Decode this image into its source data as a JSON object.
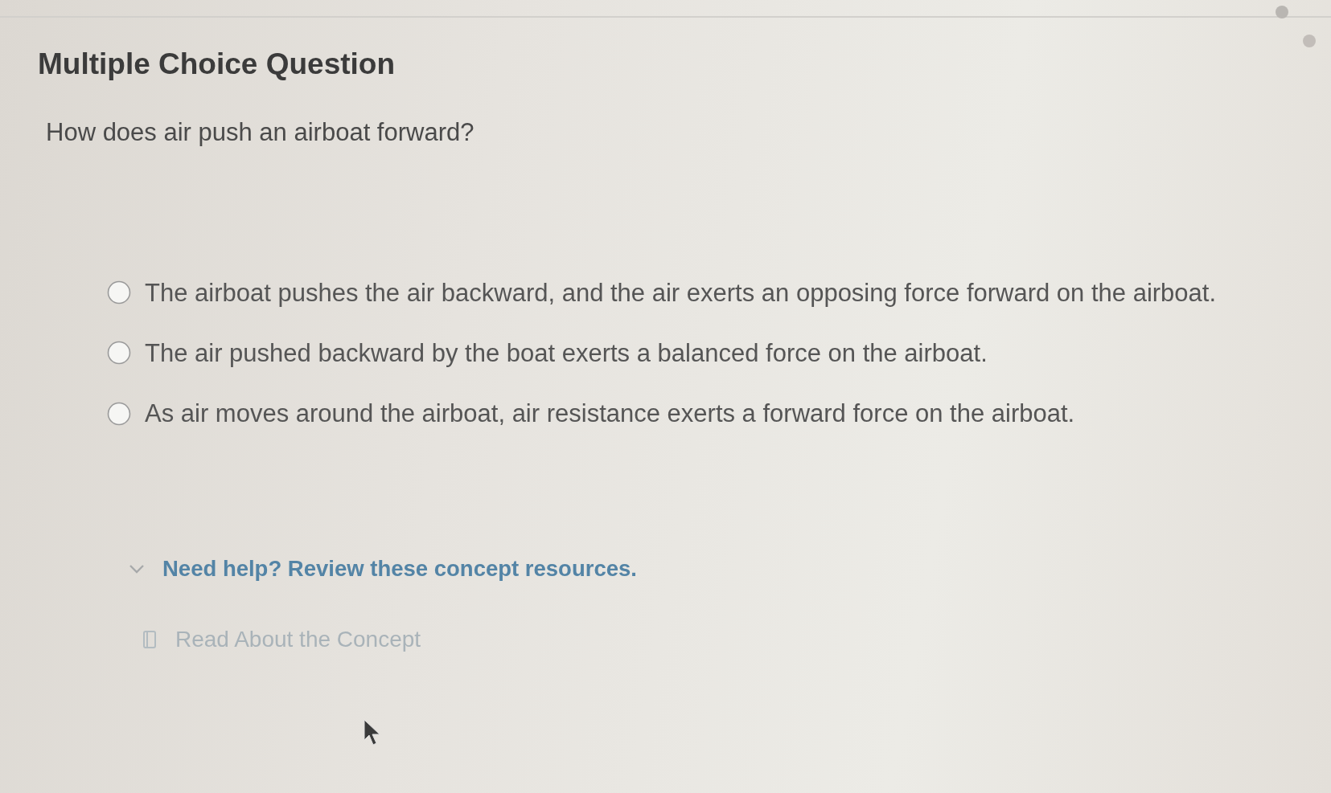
{
  "title": "Multiple Choice Question",
  "question": "How does air push an airboat forward?",
  "options": [
    {
      "text": "The airboat pushes the air backward, and the air exerts an opposing force forward on the airboat.",
      "selected": false
    },
    {
      "text": "The air pushed backward by the boat exerts a balanced force on the airboat.",
      "selected": false
    },
    {
      "text": "As air moves around the airboat, air resistance exerts a forward force on the airboat.",
      "selected": false
    }
  ],
  "help": {
    "label": "Need help? Review these concept resources.",
    "expanded": true,
    "resources": [
      {
        "label": "Read About the Concept"
      }
    ]
  }
}
